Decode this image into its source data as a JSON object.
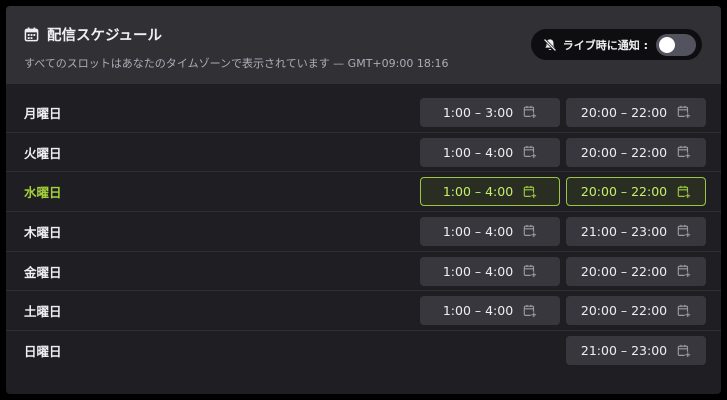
{
  "header": {
    "title": "配信スケジュール",
    "subtitle": "すべてのスロットはあなたのタイムゾーンで表示されています — GMT+09:00 18:16",
    "notify_label": "ライブ時に通知 :"
  },
  "notify_toggle": {
    "on": false
  },
  "icons": {
    "title": "calendar-icon",
    "notify": "bell-off-icon",
    "slot": "calendar-add-icon"
  },
  "colors": {
    "today_accent": "#a3d13a",
    "panel_bg": "#1f1f23",
    "header_bg": "#303035"
  },
  "schedule": [
    {
      "day": "月曜日",
      "today": false,
      "slots": [
        "1:00 – 3:00",
        "20:00 – 22:00"
      ]
    },
    {
      "day": "火曜日",
      "today": false,
      "slots": [
        "1:00 – 4:00",
        "20:00 – 22:00"
      ]
    },
    {
      "day": "水曜日",
      "today": true,
      "slots": [
        "1:00 – 4:00",
        "20:00 – 22:00"
      ]
    },
    {
      "day": "木曜日",
      "today": false,
      "slots": [
        "1:00 – 4:00",
        "21:00 – 23:00"
      ]
    },
    {
      "day": "金曜日",
      "today": false,
      "slots": [
        "1:00 – 4:00",
        "20:00 – 22:00"
      ]
    },
    {
      "day": "土曜日",
      "today": false,
      "slots": [
        "1:00 – 4:00",
        "20:00 – 22:00"
      ]
    },
    {
      "day": "日曜日",
      "today": false,
      "slots": [
        "21:00 – 23:00"
      ]
    }
  ]
}
